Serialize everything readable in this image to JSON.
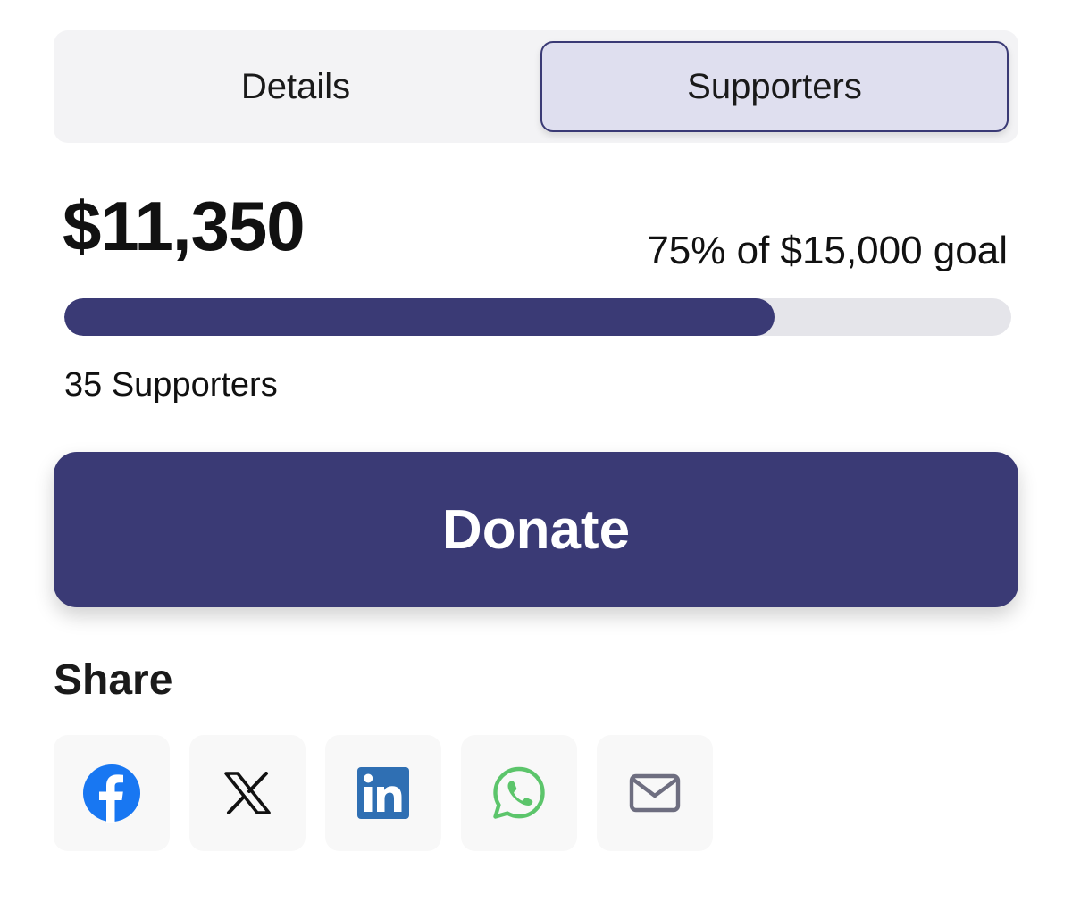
{
  "tabs": [
    {
      "label": "Details",
      "active": false
    },
    {
      "label": "Supporters",
      "active": true
    }
  ],
  "fundraiser": {
    "raised": "$11,350",
    "goal_text": "75% of $15,000 goal",
    "progress_fraction": 0.75,
    "supporters_text": "35 Supporters"
  },
  "donate_button": {
    "label": "Donate"
  },
  "share": {
    "heading": "Share",
    "icons": [
      "facebook-icon",
      "x-icon",
      "linkedin-icon",
      "whatsapp-icon",
      "email-icon"
    ]
  },
  "colors": {
    "accent": "#3a3a75",
    "active_tab_bg": "#dfdfef",
    "track": "#e5e5ea",
    "facebook": "#1877f2",
    "linkedin": "#2f6fb3",
    "whatsapp": "#5cc56b",
    "email": "#6e6e80"
  }
}
